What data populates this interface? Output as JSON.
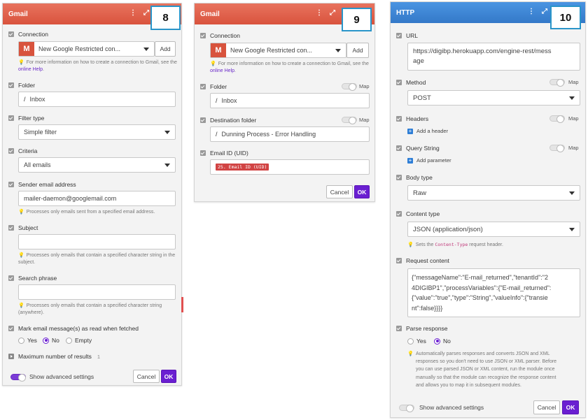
{
  "panel8": {
    "title": "Gmail",
    "badge": "8",
    "connection": {
      "label": "Connection",
      "value": "New Google Restricted con...",
      "add": "Add",
      "hint": "For more information on how to create a connection to Gmail, see the",
      "hint_link": "online Help",
      "hint_end": "."
    },
    "folder": {
      "label": "Folder",
      "value": "Inbox"
    },
    "filter_type": {
      "label": "Filter type",
      "value": "Simple filter"
    },
    "criteria": {
      "label": "Criteria",
      "value": "All emails"
    },
    "sender": {
      "label": "Sender email address",
      "value": "mailer-daemon@googlemail.com",
      "hint": "Processes only emails sent from a specified email address."
    },
    "subject": {
      "label": "Subject",
      "value": "",
      "hint": "Processes only emails that contain a specified character string in the subject."
    },
    "search": {
      "label": "Search phrase",
      "value": "",
      "hint": "Processes only emails that contain a specified character string (anywhere)."
    },
    "mark_read": {
      "label": "Mark email message(s) as read when fetched",
      "options": [
        "Yes",
        "No",
        "Empty"
      ],
      "selected": "No"
    },
    "max_results": {
      "label": "Maximum number of results",
      "value": "1"
    },
    "advanced": "Show advanced settings",
    "cancel": "Cancel",
    "ok": "OK"
  },
  "panel9": {
    "title": "Gmail",
    "badge": "9",
    "connection": {
      "label": "Connection",
      "value": "New Google Restricted con...",
      "add": "Add",
      "hint": "For more information on how to create a connection to Gmail, see the",
      "hint_link": "online Help",
      "hint_end": "."
    },
    "folder": {
      "label": "Folder",
      "value": "Inbox",
      "map": "Map"
    },
    "destination": {
      "label": "Destination folder",
      "value": "Dunning Process - Error Handling",
      "map": "Map"
    },
    "email_id": {
      "label": "Email ID (UID)",
      "tag": "25. Email ID (UID)"
    },
    "cancel": "Cancel",
    "ok": "OK"
  },
  "panel10": {
    "title": "HTTP",
    "badge": "10",
    "url": {
      "label": "URL",
      "value_line1": "https://digibp.herokuapp.com/engine-rest/mess",
      "value_line2": "age"
    },
    "method": {
      "label": "Method",
      "value": "POST",
      "map": "Map"
    },
    "headers": {
      "label": "Headers",
      "add": "Add a header",
      "map": "Map"
    },
    "query": {
      "label": "Query String",
      "add": "Add parameter",
      "map": "Map"
    },
    "body_type": {
      "label": "Body type",
      "value": "Raw"
    },
    "content_type": {
      "label": "Content type",
      "value": "JSON (application/json)",
      "hint_pre": "Sets the",
      "hint_code": "Content-Type",
      "hint_post": "request header."
    },
    "request": {
      "label": "Request content",
      "lines": [
        "{\"messageName\":\"E-mail_returned\",\"tenantId\":\"2",
        "4DIGIBP1\",\"processVariables\":{\"E-mail_returned\":",
        "{\"value\":\"true\",\"type\":\"String\",\"valueInfo\":{\"transie",
        "nt\":false}}}}"
      ]
    },
    "parse": {
      "label": "Parse response",
      "options": [
        "Yes",
        "No"
      ],
      "selected": "No",
      "hint_lines": [
        "Automatically parses responses and converts JSON and XML",
        "responses so you don't need to use JSON or XML parser. Before",
        "you can use parsed JSON or XML content, run the module once",
        "manually so that the module can recognize the response content",
        "and allows you to map it in subsequent modules."
      ]
    },
    "advanced": "Show advanced settings",
    "cancel": "Cancel",
    "ok": "OK"
  }
}
